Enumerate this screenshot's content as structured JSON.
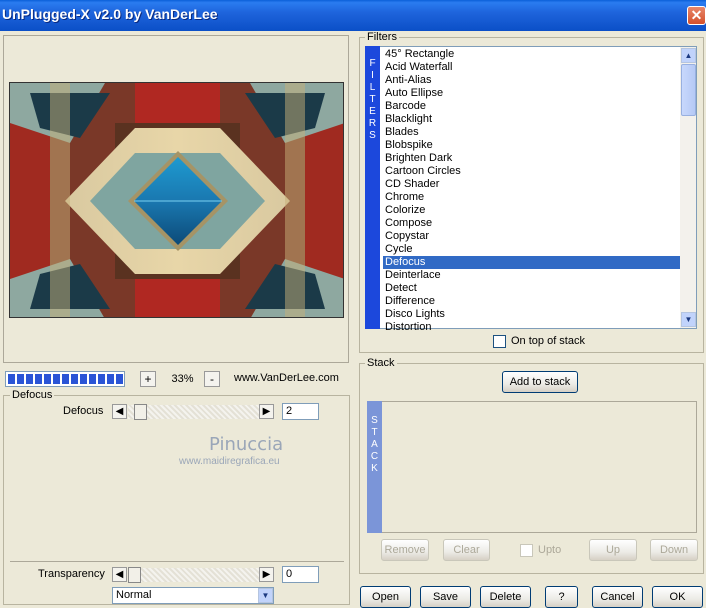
{
  "window": {
    "title": "UnPlugged-X v2.0 by VanDerLee",
    "close_glyph": "✕"
  },
  "preview": {
    "zoom": {
      "minus": "-",
      "plus": "+",
      "value": "33%"
    },
    "website": "www.VanDerLee.com",
    "progress": 1.0
  },
  "defocus_group": {
    "label": "Defocus",
    "param_label": "Defocus",
    "param_value": "2",
    "watermark_name": "Pinuccia",
    "watermark_url": "www.maidiregrafica.eu"
  },
  "transparency": {
    "label": "Transparency",
    "value": "0",
    "mode": "Normal"
  },
  "filters_group": {
    "label": "Filters",
    "side_label": [
      "F",
      "I",
      "L",
      "T",
      "E",
      "R",
      "S"
    ],
    "items": [
      "45° Rectangle",
      "Acid Waterfall",
      "Anti-Alias",
      "Auto Ellipse",
      "Barcode",
      "Blacklight",
      "Blades",
      "Blobspike",
      "Brighten Dark",
      "Cartoon Circles",
      "CD Shader",
      "Chrome",
      "Colorize",
      "Compose",
      "Copystar",
      "Cycle",
      "Defocus",
      "Deinterlace",
      "Detect",
      "Difference",
      "Disco Lights",
      "Distortion"
    ],
    "selected": "Defocus",
    "on_top_label": "On top of stack"
  },
  "stack_group": {
    "label": "Stack",
    "add_label": "Add to stack",
    "side_label": [
      "S",
      "T",
      "A",
      "C",
      "K"
    ],
    "remove_label": "Remove",
    "clear_label": "Clear",
    "upto_label": "Upto",
    "up_label": "Up",
    "down_label": "Down"
  },
  "buttons": {
    "open": "Open",
    "save": "Save",
    "delete": "Delete",
    "help": "?",
    "cancel": "Cancel",
    "ok": "OK"
  },
  "colors": {
    "accent": "#316ac5",
    "filters_side": "#1c48dc",
    "stack_side": "#7b95d8"
  }
}
